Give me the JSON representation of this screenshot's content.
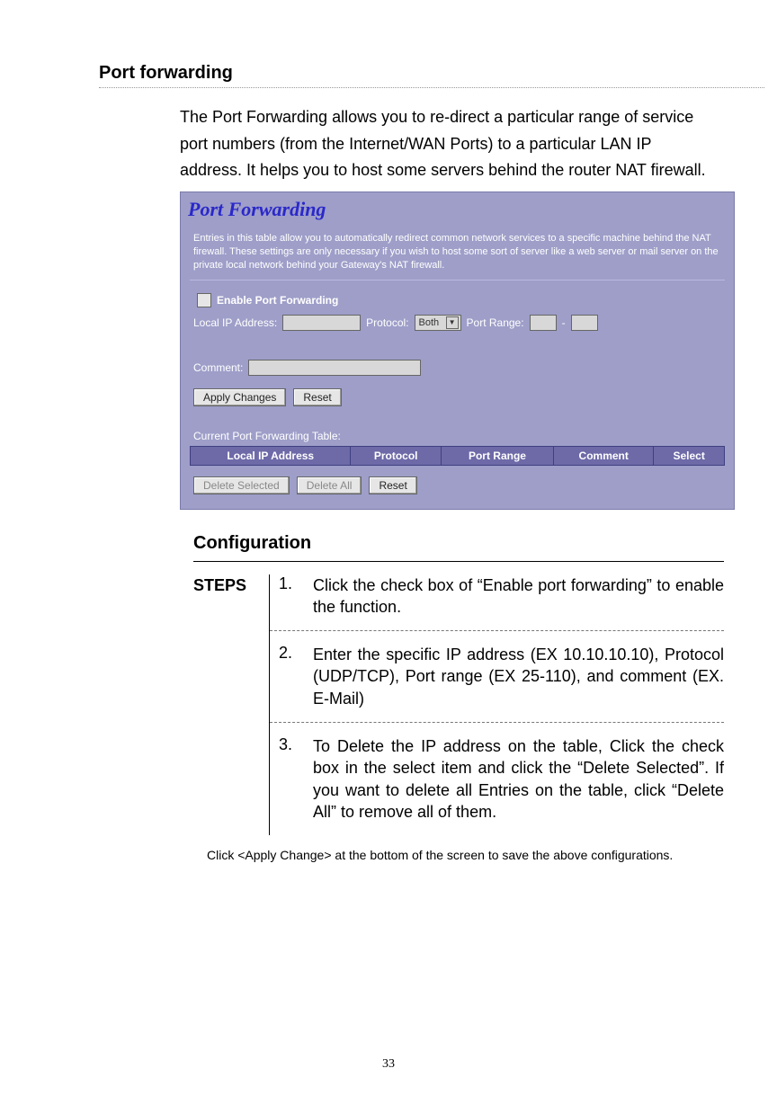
{
  "section": {
    "title": "Port forwarding",
    "intro": "The Port Forwarding allows you to re-direct a particular range of service port numbers (from the Internet/WAN Ports) to a particular LAN IP address. It helps you to host some servers behind the router NAT firewall."
  },
  "panel": {
    "heading": "Port Forwarding",
    "description": "Entries in this table allow you to automatically redirect common network services to a specific machine behind the NAT firewall. These settings are only necessary if you wish to host some sort of server like a web server or mail server on the private local network behind your Gateway's NAT firewall.",
    "enable_label": "Enable Port Forwarding",
    "ip_label": "Local IP Address:",
    "protocol_label": "Protocol:",
    "protocol_value": "Both",
    "portrange_label": "Port Range:",
    "portrange_sep": "-",
    "comment_label": "Comment:",
    "apply_btn": "Apply Changes",
    "reset_btn": "Reset",
    "table_title": "Current Port Forwarding Table:",
    "columns": {
      "ip": "Local IP Address",
      "protocol": "Protocol",
      "range": "Port Range",
      "comment": "Comment",
      "select": "Select"
    },
    "delete_selected_btn": "Delete Selected",
    "delete_all_btn": "Delete All",
    "reset2_btn": "Reset"
  },
  "config": {
    "heading": "Configuration",
    "steps_label": "STEPS",
    "steps": [
      {
        "n": "1.",
        "text": "Click the check box of “Enable port forwarding” to enable the function."
      },
      {
        "n": "2.",
        "text": "Enter the specific IP address (EX 10.10.10.10), Protocol (UDP/TCP), Port range (EX 25-110), and comment (EX. E-Mail)"
      },
      {
        "n": "3.",
        "text": "To Delete the IP address on the table, Click the check box in the select item and click the “Delete Selected”. If you want to delete all Entries on the table, click “Delete All” to remove all of them."
      }
    ],
    "footnote": "Click <Apply Change> at the bottom of the screen to save the above configurations."
  },
  "page_number": "33"
}
